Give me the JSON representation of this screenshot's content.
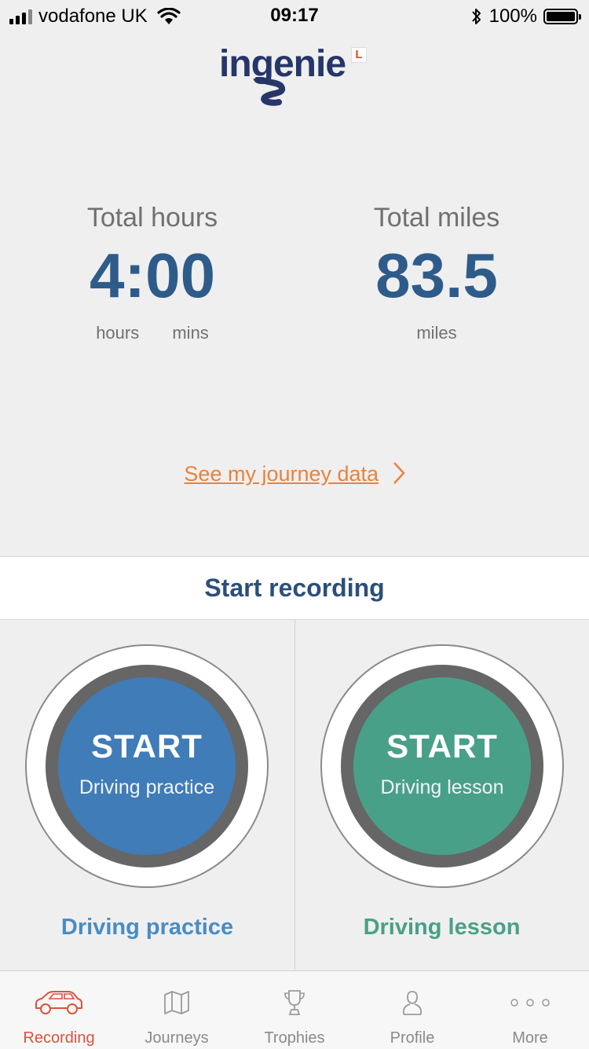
{
  "status_bar": {
    "carrier": "vodafone UK",
    "time": "09:17",
    "battery": "100%"
  },
  "logo": {
    "text": "ingenie",
    "badge": "L"
  },
  "stats": {
    "hours": {
      "title": "Total hours",
      "value": "4:00",
      "unit_hours": "hours",
      "unit_mins": "mins"
    },
    "miles": {
      "title": "Total miles",
      "value": "83.5",
      "unit": "miles"
    }
  },
  "journey_link": "See my journey data",
  "start_recording": "Start recording",
  "buttons": {
    "practice": {
      "big": "START",
      "small": "Driving practice",
      "caption": "Driving practice",
      "color": "#3f7cb8"
    },
    "lesson": {
      "big": "START",
      "small": "Driving lesson",
      "caption": "Driving lesson",
      "color": "#49a088"
    }
  },
  "tabs": [
    {
      "label": "Recording",
      "icon": "car-icon",
      "active": true
    },
    {
      "label": "Journeys",
      "icon": "map-icon",
      "active": false
    },
    {
      "label": "Trophies",
      "icon": "trophy-icon",
      "active": false
    },
    {
      "label": "Profile",
      "icon": "person-icon",
      "active": false
    },
    {
      "label": "More",
      "icon": "more-dots-icon",
      "active": false
    }
  ],
  "colors": {
    "accent": "#d9533e",
    "link": "#e8833a",
    "stat_value": "#2e5c8a"
  }
}
